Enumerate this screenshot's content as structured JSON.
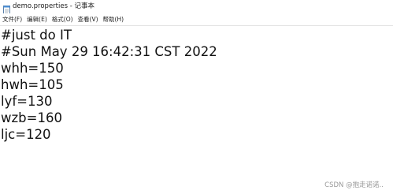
{
  "window": {
    "title": "demo.properties - 记事本"
  },
  "menu": {
    "items": [
      {
        "label": "文件(F)"
      },
      {
        "label": "编辑(E)"
      },
      {
        "label": "格式(O)"
      },
      {
        "label": "查看(V)"
      },
      {
        "label": "帮助(H)"
      }
    ]
  },
  "editor": {
    "lines": [
      "#just do IT",
      "#Sun May 29 16:42:31 CST 2022",
      "whh=150",
      "hwh=105",
      "lyf=130",
      "wzb=160",
      "ljc=120"
    ]
  },
  "watermark": {
    "text": "CSDN @抱走诺诺.."
  },
  "icons": {
    "app": "notepad-icon"
  }
}
